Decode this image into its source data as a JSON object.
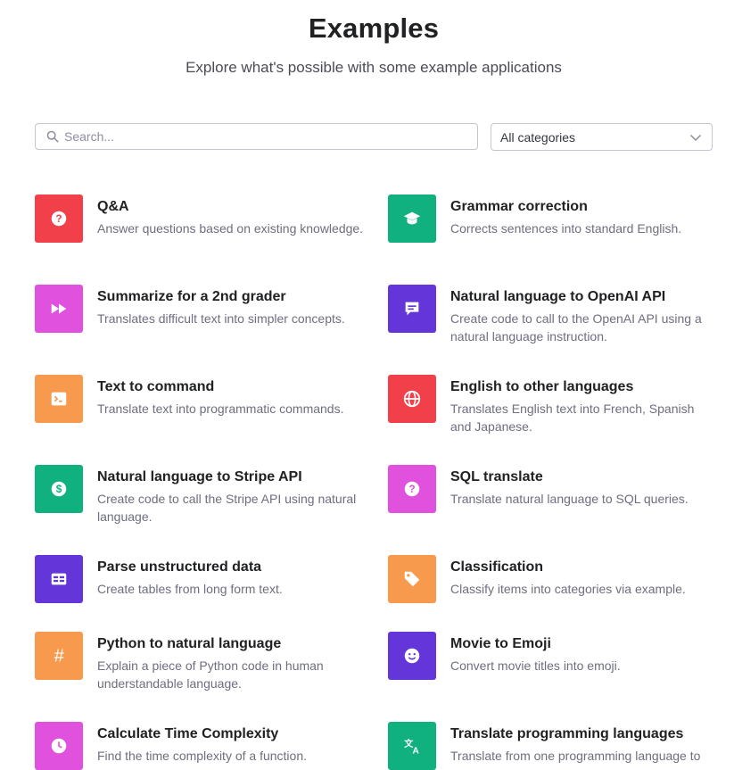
{
  "header": {
    "title": "Examples",
    "subtitle": "Explore what's possible with some example applications"
  },
  "search": {
    "placeholder": "Search...",
    "value": ""
  },
  "category_filter": {
    "selected": "All categories"
  },
  "colors": {
    "red": "#ef4146",
    "pink": "#dd5ce5",
    "orange": "#f4a04f",
    "green": "#10a37f",
    "purple": "#6e3be0"
  },
  "examples": [
    {
      "title": "Q&A",
      "description": "Answer questions based on existing knowledge.",
      "icon": "question-icon",
      "color": "#f2404a"
    },
    {
      "title": "Grammar correction",
      "description": "Corrects sentences into standard English.",
      "icon": "graduation-cap-icon",
      "color": "#10b07f"
    },
    {
      "title": "Summarize for a 2nd grader",
      "description": "Translates difficult text into simpler concepts.",
      "icon": "fast-forward-icon",
      "color": "#e052dd"
    },
    {
      "title": "Natural language to OpenAI API",
      "description": "Create code to call to the OpenAI API using a natural language instruction.",
      "icon": "chat-icon",
      "color": "#6435d8"
    },
    {
      "title": "Text to command",
      "description": "Translate text into programmatic commands.",
      "icon": "terminal-icon",
      "color": "#f79a4e"
    },
    {
      "title": "English to other languages",
      "description": "Translates English text into French, Spanish and Japanese.",
      "icon": "globe-icon",
      "color": "#f2404a"
    },
    {
      "title": "Natural language to Stripe API",
      "description": "Create code to call the Stripe API using natural language.",
      "icon": "dollar-icon",
      "color": "#10b07f"
    },
    {
      "title": "SQL translate",
      "description": "Translate natural language to SQL queries.",
      "icon": "question-icon",
      "color": "#e052dd"
    },
    {
      "title": "Parse unstructured data",
      "description": "Create tables from long form text.",
      "icon": "table-icon",
      "color": "#6435d8"
    },
    {
      "title": "Classification",
      "description": "Classify items into categories via example.",
      "icon": "tag-icon",
      "color": "#f79a4e"
    },
    {
      "title": "Python to natural language",
      "description": "Explain a piece of Python code in human understandable language.",
      "icon": "hash-icon",
      "color": "#f79a4e"
    },
    {
      "title": "Movie to Emoji",
      "description": "Convert movie titles into emoji.",
      "icon": "smiley-icon",
      "color": "#6435d8"
    },
    {
      "title": "Calculate Time Complexity",
      "description": "Find the time complexity of a function.",
      "icon": "clock-icon",
      "color": "#e052dd"
    },
    {
      "title": "Translate programming languages",
      "description": "Translate from one programming language to",
      "icon": "translate-icon",
      "color": "#10b07f"
    }
  ]
}
